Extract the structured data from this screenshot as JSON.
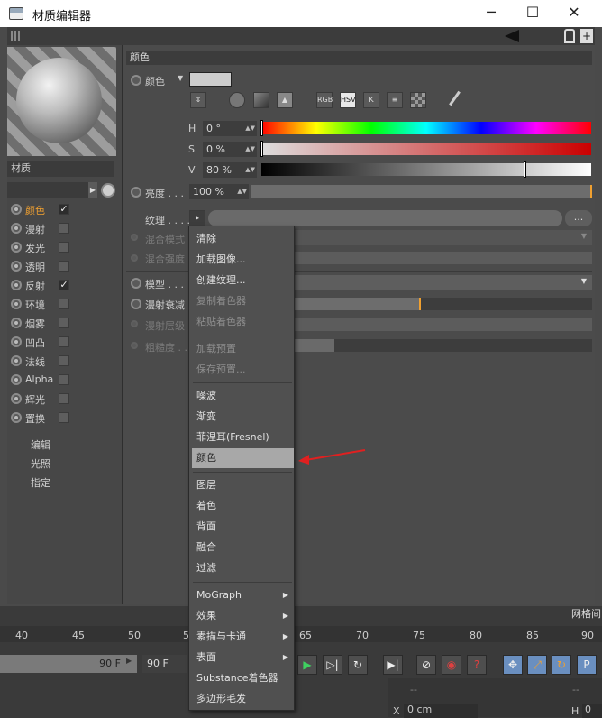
{
  "window": {
    "title": "材质编辑器",
    "minimize": "─",
    "maximize": "☐",
    "close": "✕"
  },
  "material": {
    "name": "材质"
  },
  "channels": [
    {
      "label": "颜色",
      "checked": true,
      "active": true
    },
    {
      "label": "漫射",
      "checked": false
    },
    {
      "label": "发光",
      "checked": false
    },
    {
      "label": "透明",
      "checked": false
    },
    {
      "label": "反射",
      "checked": true
    },
    {
      "label": "环境",
      "checked": false
    },
    {
      "label": "烟雾",
      "checked": false
    },
    {
      "label": "凹凸",
      "checked": false
    },
    {
      "label": "法线",
      "checked": false
    },
    {
      "label": "Alpha",
      "checked": false
    },
    {
      "label": "辉光",
      "checked": false
    },
    {
      "label": "置换",
      "checked": false
    }
  ],
  "extra_sections": [
    "编辑",
    "光照",
    "指定"
  ],
  "panel": {
    "section_title": "颜色",
    "color_label": "颜色",
    "color_modes": [
      "RGB",
      "HSV",
      "K"
    ],
    "h_label": "H",
    "h_value": "0 °",
    "s_label": "S",
    "s_value": "0 %",
    "v_label": "V",
    "v_value": "80 %",
    "v_level": 0.8,
    "brightness_label": "亮度 . . .",
    "brightness_value": "100 %",
    "texture_label": "纹理 . . . .",
    "texture_btn": "...",
    "blend_mode_label": "混合模式",
    "blend_strength_label": "混合强度",
    "model_label": "模型 . . .",
    "diffuse_falloff_label": "漫射衰减",
    "diffuse_level_label": "漫射层级",
    "roughness_label": "粗糙度 . ."
  },
  "menu": {
    "items_1": [
      "清除",
      "加载图像...",
      "创建纹理...",
      "复制着色器",
      "粘贴着色器"
    ],
    "items_2": [
      "加载预置",
      "保存预置..."
    ],
    "items_3": [
      "噪波",
      "渐变",
      "菲涅耳(Fresnel)",
      "颜色"
    ],
    "items_4": [
      "图层",
      "着色",
      "背面",
      "融合",
      "过滤"
    ],
    "items_5": [
      "MoGraph",
      "效果",
      "素描与卡通",
      "表面",
      "Substance着色器",
      "多边形毛发"
    ],
    "highlighted": "颜色"
  },
  "timeline": {
    "ticks": [
      "40",
      "45",
      "50",
      "5",
      "65",
      "70",
      "75",
      "80",
      "85",
      "90"
    ],
    "frame_end_a": "90 F",
    "frame_end_b": "90 F",
    "right_tab": "网格间",
    "coord_x_label": "X",
    "coord_x_value": "0 cm",
    "coord_h_label": "H",
    "coord_h_value": "0",
    "dash_a": "--",
    "dash_b": "--"
  },
  "colors": {
    "accent": "#f0a030",
    "arrow": "#e02020",
    "highlight": "#a8a8a8"
  }
}
